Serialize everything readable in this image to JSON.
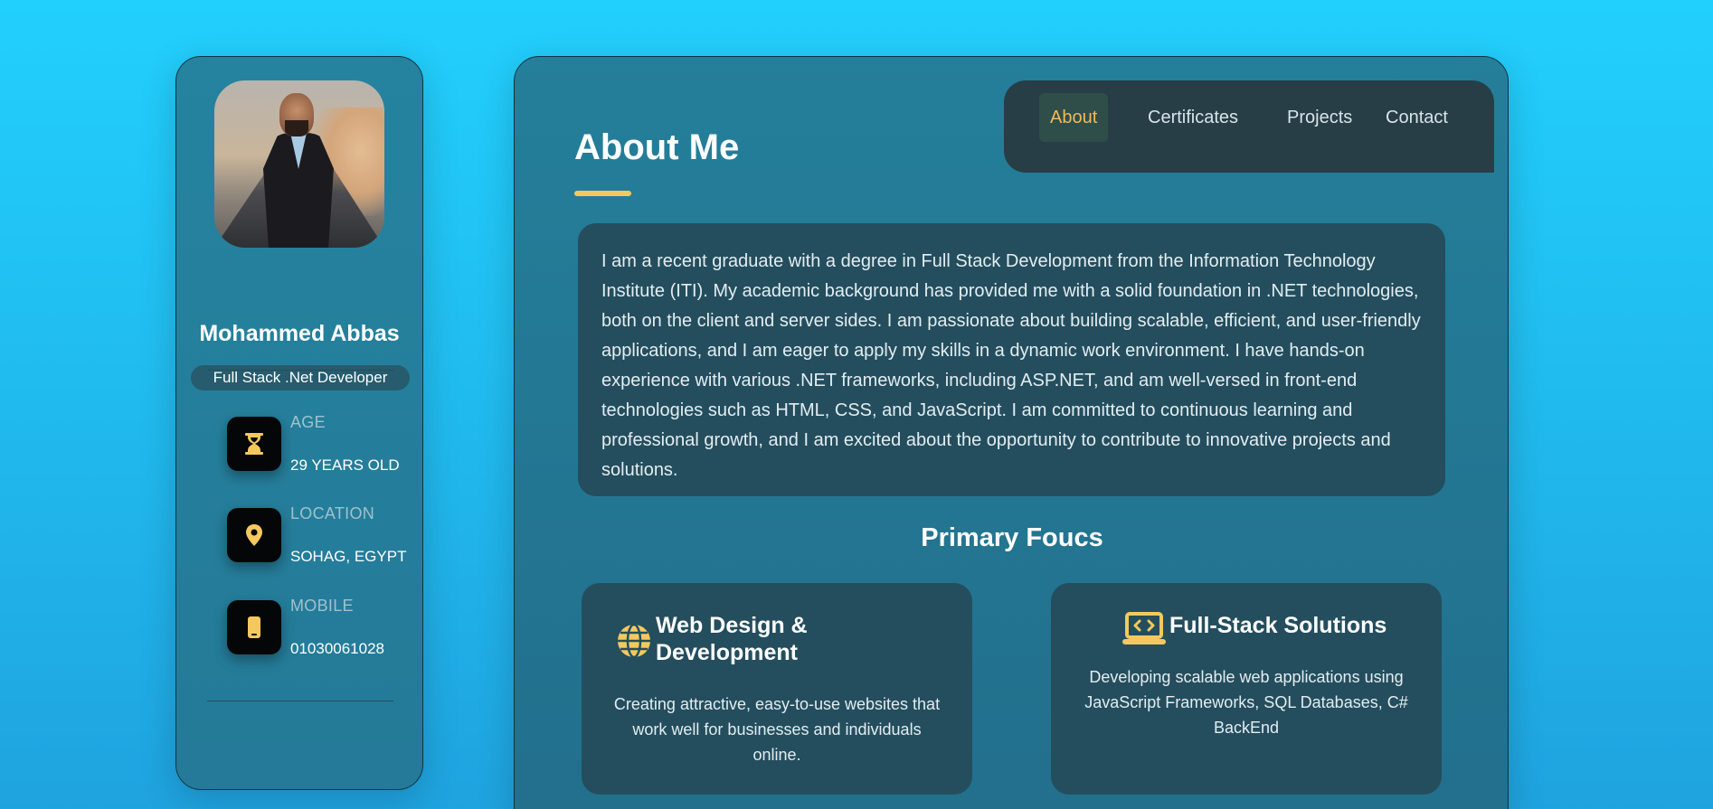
{
  "profile": {
    "name": "Mohammed Abbas",
    "role": "Full Stack .Net Developer",
    "photo_alt": "Mohammed Abbas"
  },
  "info": [
    {
      "icon": "hourglass-icon",
      "label": "AGE",
      "value": "29 YEARS OLD"
    },
    {
      "icon": "location-pin-icon",
      "label": "LOCATION",
      "value": "SOHAG, EGYPT"
    },
    {
      "icon": "mobile-phone-icon",
      "label": "MOBILE",
      "value": "01030061028"
    }
  ],
  "nav": {
    "items": [
      "About",
      "Certificates",
      "Projects",
      "Contact"
    ],
    "active": "About"
  },
  "about": {
    "title": "About Me",
    "text": "I am a recent graduate with a degree in Full Stack Development from the Information Technology Institute (ITI). My academic background has provided me with a solid foundation in .NET technologies, both on the client and server sides. I am passionate about building scalable, efficient, and user-friendly applications, and I am eager to apply my skills in a dynamic work environment. I have hands-on experience with various .NET frameworks, including ASP.NET, and am well-versed in front-end technologies such as HTML, CSS, and JavaScript. I am committed to continuous learning and professional growth, and I am excited about the opportunity to contribute to innovative projects and solutions."
  },
  "focus": {
    "title": "Primary Foucs",
    "cards": [
      {
        "icon": "globe-icon",
        "title": "Web Design & Development",
        "description": "Creating attractive, easy-to-use websites that work well for businesses and individuals online."
      },
      {
        "icon": "laptop-code-icon",
        "title": "Full-Stack Solutions",
        "description": "Developing scalable web applications using JavaScript Frameworks, SQL Databases, C# BackEnd"
      }
    ]
  },
  "colors": {
    "accent": "#f5c85f",
    "nav_active": "#f5b955",
    "background": "#22c8f8",
    "panel": "#247f9a",
    "card": "#244e5e"
  }
}
